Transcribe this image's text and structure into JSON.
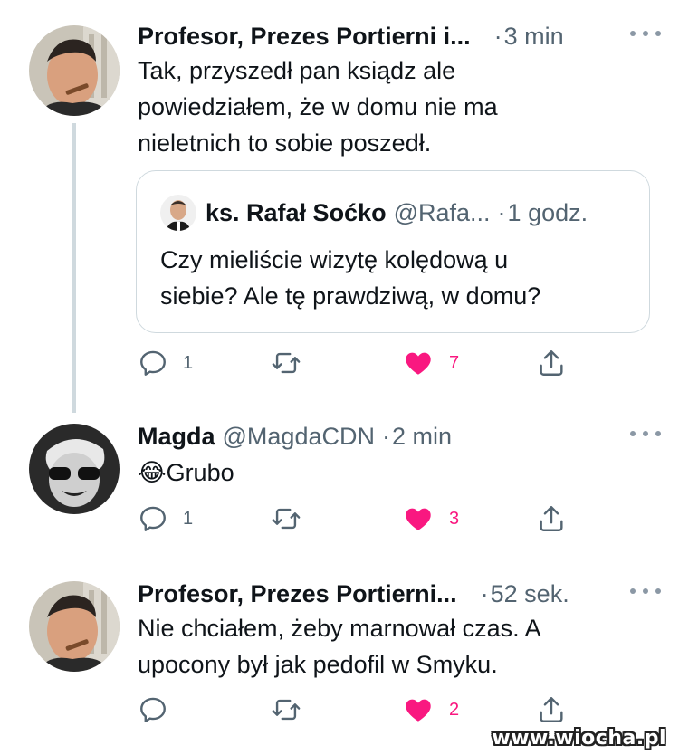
{
  "tweets": [
    {
      "name": "Profesor, Prezes Portierni i...",
      "time": "3 min",
      "text_lines": [
        "Tak, przyszedł pan ksiądz ale",
        "powiedziałem, że w domu nie ma",
        "nieletnich to sobie poszedł."
      ],
      "quote": {
        "name": "ks. Rafał Soćko",
        "handle": "@Rafa...",
        "time": "1 godz.",
        "text_lines": [
          "Czy mieliście wizytę kolędową u",
          "siebie? Ale tę prawdziwą, w domu?"
        ]
      },
      "replies": "1",
      "likes": "7"
    },
    {
      "name": "Magda",
      "handle": "@MagdaCDN",
      "time": "2 min",
      "emoji": "😂",
      "text": "Grubo",
      "replies": "1",
      "likes": "3"
    },
    {
      "name": "Profesor, Prezes Portierni...",
      "time": "52 sek.",
      "text_lines": [
        "Nie chciałem, żeby marnował czas. A",
        "upocony był jak pedofil w Smyku."
      ],
      "replies": "",
      "likes": "2"
    }
  ],
  "watermark": "www.wiocha.pl",
  "colors": {
    "like": "#f91880",
    "secondary_text": "#536471",
    "thread_line": "#cfd9de"
  },
  "icons": [
    "reply-icon",
    "retweet-icon",
    "heart-icon",
    "share-icon",
    "more-icon"
  ]
}
